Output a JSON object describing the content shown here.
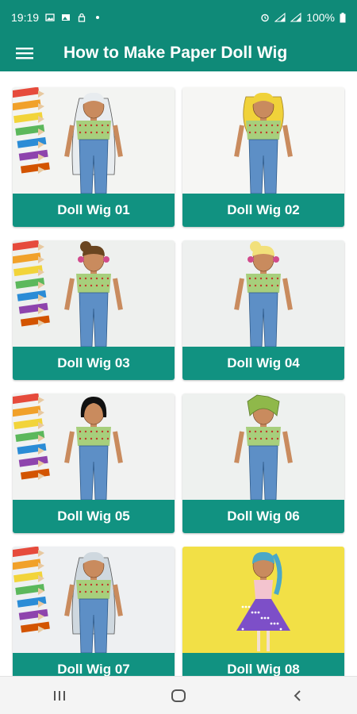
{
  "status_bar": {
    "time": "19:19",
    "battery": "100%"
  },
  "app_bar": {
    "title": "How to Make Paper Doll Wig",
    "menu_icon": "hamburger-menu-icon"
  },
  "colors": {
    "primary": "#0f8a78",
    "label_bg": "#119281"
  },
  "items": [
    {
      "label": "Doll Wig 01",
      "hair": "#e8ecef",
      "bg": "#f3f4f2",
      "style": "long-wavy"
    },
    {
      "label": "Doll Wig 02",
      "hair": "#f0d23a",
      "bg": "#f6f6f4",
      "style": "curly"
    },
    {
      "label": "Doll Wig 03",
      "hair": "#6a4520",
      "bg": "#eef0ee",
      "style": "bun"
    },
    {
      "label": "Doll Wig 04",
      "hair": "#f2e07a",
      "bg": "#eef0ef",
      "style": "bun"
    },
    {
      "label": "Doll Wig 05",
      "hair": "#111111",
      "bg": "#f1f2f1",
      "style": "bob"
    },
    {
      "label": "Doll Wig 06",
      "hair": "#8fb84a",
      "bg": "#eef1ef",
      "style": "short"
    },
    {
      "label": "Doll Wig 07",
      "hair": "#cfd8df",
      "bg": "#eef0f2",
      "style": "long-straight"
    },
    {
      "label": "Doll Wig 08",
      "hair": "#4aa8c8",
      "bg": "#f2e046",
      "style": "dress"
    }
  ],
  "nav": {
    "recents_icon": "recents-icon",
    "home_icon": "home-icon",
    "back_icon": "back-icon"
  }
}
